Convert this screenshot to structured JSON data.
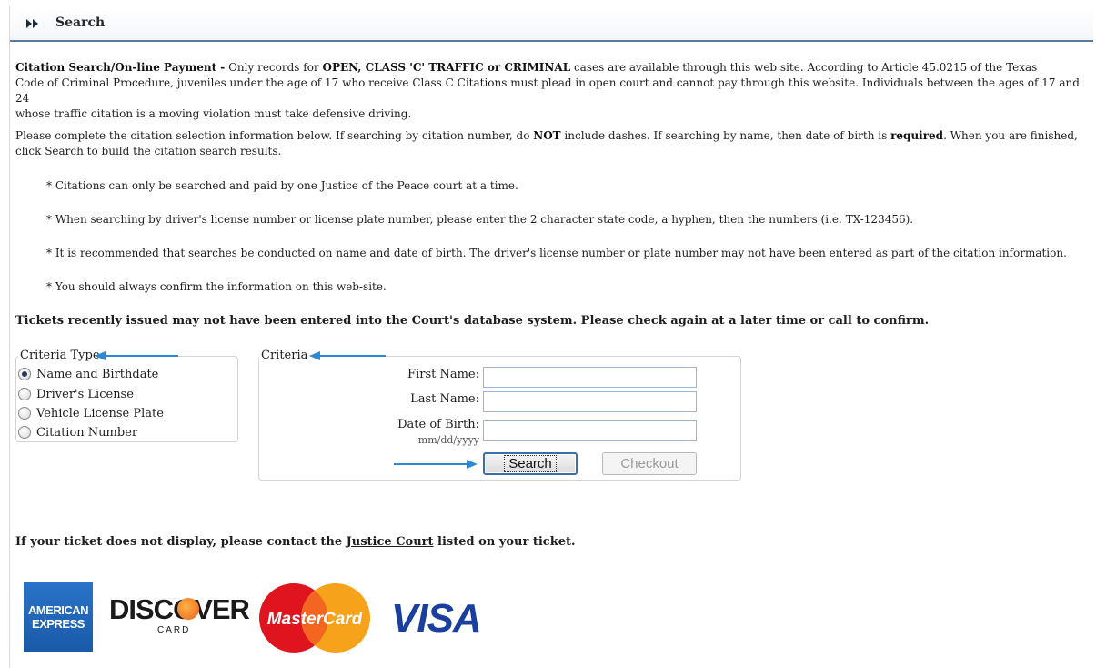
{
  "header": {
    "title": "Search"
  },
  "intro": {
    "lead_bold": "Citation Search/On-line Payment -",
    "part1": " Only records for ",
    "bold1": "OPEN, CLASS 'C' TRAFFIC or CRIMINAL",
    "part2": " cases are available through this web site.  According to Article 45.0215 of the Texas",
    "line2": "Code of Criminal Procedure, juveniles under the age of 17 who receive Class C Citations must plead in open court and cannot pay through this website.  Individuals between the ages of 17 and 24",
    "line3": "whose traffic citation is a moving violation must take defensive driving."
  },
  "instructions": {
    "part1": "Please complete the citation selection information below. If searching by citation number, do ",
    "bold1": "NOT",
    "part2": " include dashes. If searching by name, then date of birth is ",
    "bold2": "required",
    "part3": ". When you are finished,",
    "line2": "click Search to build the citation search results."
  },
  "bullets": [
    "* Citations can only be searched and paid by one Justice of the Peace court at a time.",
    "* When searching by driver's license number or license plate number, please enter the 2 character state code, a hyphen, then the numbers (i.e. TX-123456).",
    "* It is recommended that searches be conducted on name and date of birth. The driver's license number or plate number may not have been entered as part of the citation information.",
    "* You should always confirm the information on this web-site."
  ],
  "warning": "Tickets recently issued may not have been entered into the Court's database system.  Please check again at a later time or call to confirm.",
  "criteria_type": {
    "legend": "Criteria Type",
    "options": [
      "Name and Birthdate",
      "Driver's License",
      "Vehicle License Plate",
      "Citation Number"
    ],
    "selected": "Name and Birthdate"
  },
  "criteria": {
    "legend": "Criteria",
    "first_name_label": "First Name:",
    "last_name_label": "Last Name:",
    "dob_label": "Date of Birth:",
    "dob_hint": "mm/dd/yyyy",
    "first_name_value": "",
    "last_name_value": "",
    "dob_value": ""
  },
  "buttons": {
    "search": "Search",
    "checkout": "Checkout"
  },
  "contact": {
    "part1": "If your ticket does not display, please contact the ",
    "link": "Justice Court",
    "part2": " listed on your ticket."
  },
  "cards": {
    "amex_line1": "AMERICAN",
    "amex_line2": "EXPRESS",
    "discover_word": "DISCOVER",
    "discover_sub": "CARD",
    "mastercard": "MasterCard",
    "visa": "VISA"
  },
  "colors": {
    "accent_blue": "#2b8ad8",
    "header_rule": "#5a7aa0",
    "input_border": "#9fb6d0"
  }
}
